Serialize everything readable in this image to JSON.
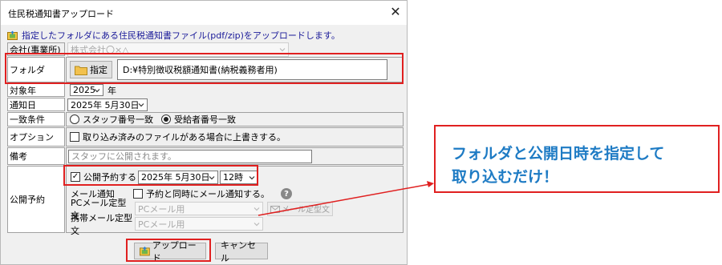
{
  "dialog": {
    "title": "住民税通知書アップロード",
    "close_icon": "close-icon",
    "info_text": "指定したフォルダにある住民税通知書ファイル(pdf/zip)をアップロードします。",
    "info_icon": "upload-info-icon"
  },
  "form": {
    "company": {
      "label": "会社(事業所)",
      "value": "株式会社〇×△"
    },
    "folder": {
      "label": "フォルダ",
      "button": "指定",
      "path": "D:¥特別徴収税額通知書(納税義務者用)"
    },
    "year": {
      "label": "対象年",
      "value": "2025",
      "suffix": "年"
    },
    "notify_date": {
      "label": "通知日",
      "value": "2025年 5月30日"
    },
    "match": {
      "label": "一致条件",
      "option1": "スタッフ番号一致",
      "option2": "受給者番号一致",
      "selected": "受給者番号一致"
    },
    "options": {
      "label": "オプション",
      "overwrite": "取り込み済みのファイルがある場合に上書きする。"
    },
    "memo": {
      "label": "備考",
      "placeholder": "スタッフに公開されます。"
    },
    "publish": {
      "label": "公開予約",
      "schedule_check": "公開予約する",
      "schedule_date": "2025年 5月30日",
      "schedule_time": "12時",
      "mail_label": "メール通知",
      "mail_check": "予約と同時にメール通知する。",
      "pc_label": "PCメール定型文",
      "pc_value": "PCメール用",
      "mobile_label": "携帯メール定型文",
      "mobile_value": "PCメール用",
      "template_button": "メール定型文"
    }
  },
  "buttons": {
    "upload": "アップロード",
    "cancel": "キャンセル"
  },
  "callout": {
    "line1": "フォルダと公開日時を指定して",
    "line2": "取り込むだけ！"
  },
  "colors": {
    "highlight": "#e02020",
    "callout_text": "#1e7bc4"
  }
}
